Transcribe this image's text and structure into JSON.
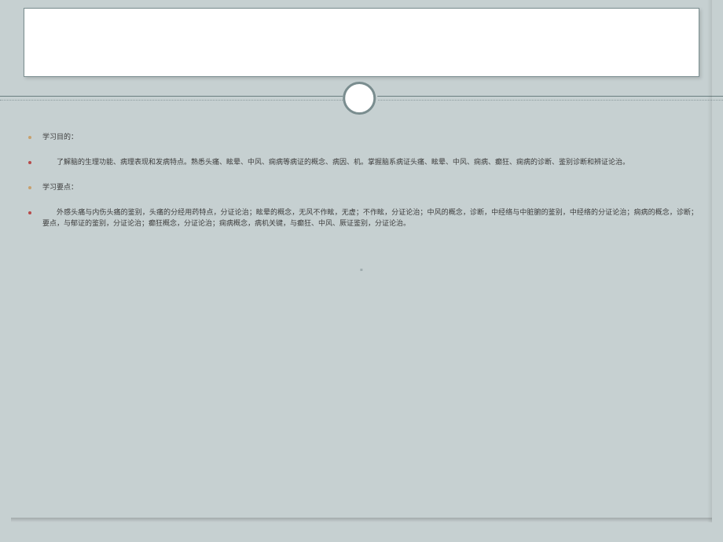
{
  "title": "",
  "bullets": [
    {
      "type": "heading",
      "color": "tan",
      "text": "学习目的："
    },
    {
      "type": "para",
      "color": "red",
      "text": "了解脑的生理功能、病理表现和发病特点。熟悉头痛、眩晕、中风、痫病等病证的概念、病因、机。掌握脑系病证头痛、眩晕、中风、痫病、癫狂、痫病的诊断、鉴别诊断和辨证论治。"
    },
    {
      "type": "heading",
      "color": "tan",
      "text": "学习要点："
    },
    {
      "type": "para",
      "color": "red",
      "text": "外感头痛与内伤头痛的鉴别，头痛的分经用药特点，分证论治；眩晕的概念，无风不作眩，无虚；不作眩，分证论治；中风的概念，诊断，中经络与中脏腑的鉴别，中经络的分证论治；痫病的概念，诊断；要点，与郁证的鉴别，分证论治；癫狂概念，分证论治；痫病概念，病机关键，与癫狂、中风、厥证鉴别，分证论治。"
    }
  ]
}
